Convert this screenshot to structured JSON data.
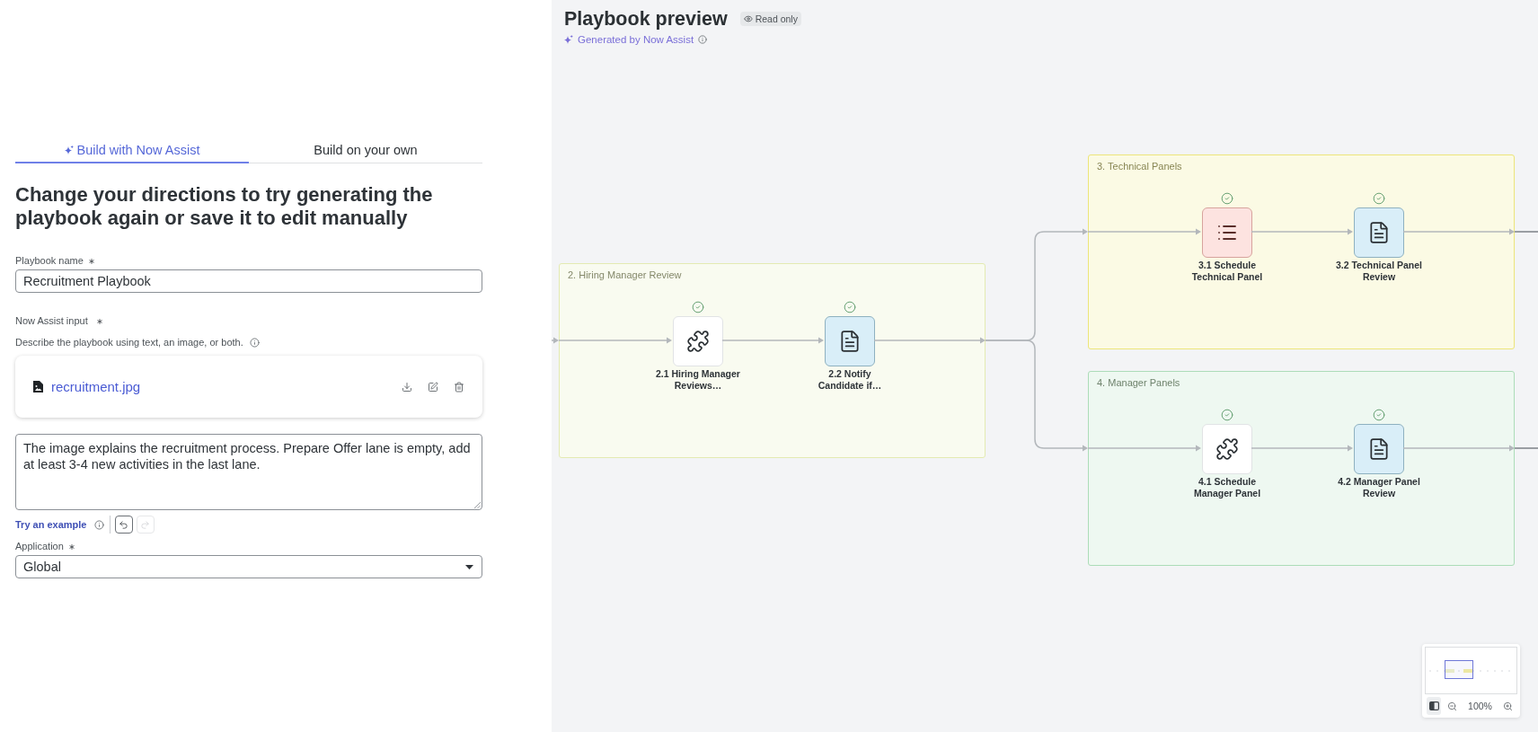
{
  "tabs": [
    {
      "label": "Build with Now Assist",
      "kind": "assist",
      "selected": true
    },
    {
      "label": "Build on your own",
      "kind": "manual",
      "selected": false
    }
  ],
  "form": {
    "heading": "Change your directions to try generating the playbook again or save it to edit manually",
    "playbook_name": {
      "label": "Playbook name",
      "required": true,
      "value": "Recruitment Playbook"
    },
    "now_assist_input": {
      "label": "Now Assist input",
      "required": true,
      "hint": "Describe the playbook using text, an image, or both.",
      "attachment": "recruitment.jpg",
      "prompt": "The image explains the recruitment process. Prepare Offer lane is empty, add at least 3-4 new activities in the last lane."
    },
    "example_link": "Try an example",
    "undo": {
      "disabled": false
    },
    "redo": {
      "disabled": true
    },
    "application": {
      "label": "Application",
      "required": true,
      "value": "Global"
    }
  },
  "preview": {
    "title": "Playbook preview",
    "badge": "Read only",
    "subtitle": "Generated by Now Assist",
    "lanes": [
      {
        "title": "2. Hiring Manager Review",
        "color": "#e3eab2",
        "activities": [
          {
            "label": "2.1 Hiring Manager Reviews…",
            "kind": "component",
            "completed": true
          },
          {
            "label": "2.2 Notify Candidate if…",
            "kind": "document",
            "completed": true
          }
        ]
      },
      {
        "title": "3. Technical Panels",
        "color": "#ece57a",
        "activities": [
          {
            "label": "3.1 Schedule Technical Panel",
            "kind": "list",
            "completed": true
          },
          {
            "label": "3.2 Technical Panel Review",
            "kind": "document",
            "completed": true
          }
        ]
      },
      {
        "title": "4. Manager Panels",
        "color": "#acdcb8",
        "activities": [
          {
            "label": "4.1 Schedule Manager Panel",
            "kind": "component",
            "completed": true
          },
          {
            "label": "4.2 Manager Panel Review",
            "kind": "document",
            "completed": true
          }
        ]
      }
    ],
    "minimap": {
      "on": true
    },
    "zoom": "100%"
  }
}
